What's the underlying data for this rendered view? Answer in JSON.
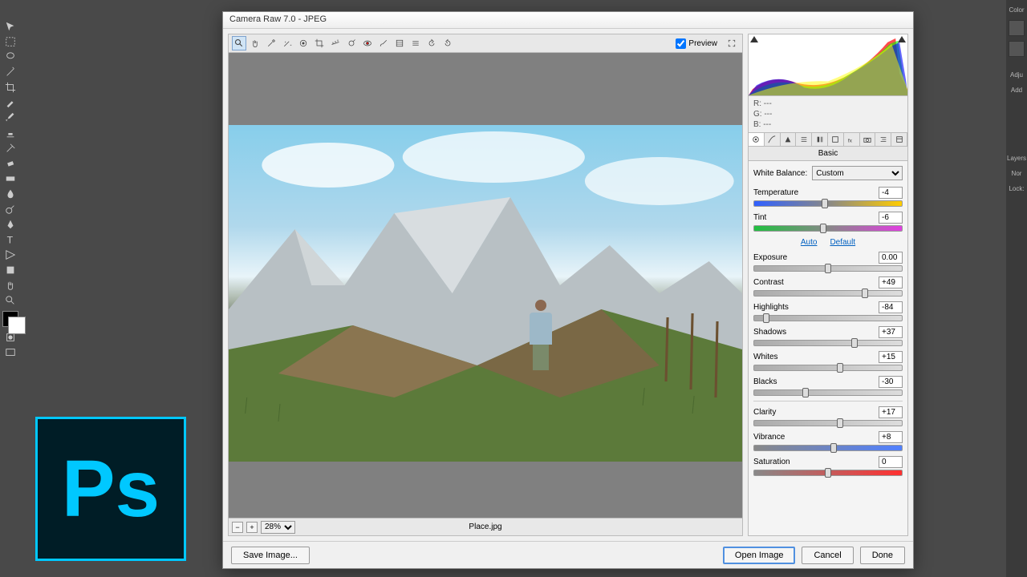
{
  "window": {
    "title": "Camera Raw 7.0  -  JPEG"
  },
  "preview": {
    "label": "Preview",
    "checked": true
  },
  "zoom": {
    "value": "28%"
  },
  "filename": "Place.jpg",
  "rgb": {
    "r": "R:    ---",
    "g": "G:    ---",
    "b": "B:    ---"
  },
  "panel_title": "Basic",
  "wb": {
    "label": "White Balance:",
    "value": "Custom"
  },
  "sliders": {
    "temperature": {
      "label": "Temperature",
      "value": "-4",
      "pos": 48
    },
    "tint": {
      "label": "Tint",
      "value": "-6",
      "pos": 47
    },
    "exposure": {
      "label": "Exposure",
      "value": "0.00",
      "pos": 50
    },
    "contrast": {
      "label": "Contrast",
      "value": "+49",
      "pos": 75
    },
    "highlights": {
      "label": "Highlights",
      "value": "-84",
      "pos": 8
    },
    "shadows": {
      "label": "Shadows",
      "value": "+37",
      "pos": 68
    },
    "whites": {
      "label": "Whites",
      "value": "+15",
      "pos": 58
    },
    "blacks": {
      "label": "Blacks",
      "value": "-30",
      "pos": 35
    },
    "clarity": {
      "label": "Clarity",
      "value": "+17",
      "pos": 58
    },
    "vibrance": {
      "label": "Vibrance",
      "value": "+8",
      "pos": 54
    },
    "saturation": {
      "label": "Saturation",
      "value": "0",
      "pos": 50
    }
  },
  "links": {
    "auto": "Auto",
    "default": "Default"
  },
  "buttons": {
    "save": "Save Image...",
    "open": "Open Image",
    "cancel": "Cancel",
    "done": "Done"
  },
  "logo": "Ps",
  "right_rail": {
    "color": "Color",
    "adj": "Adju",
    "add": "Add",
    "layers": "Layers",
    "normal": "Nor",
    "lock": "Lock:"
  }
}
